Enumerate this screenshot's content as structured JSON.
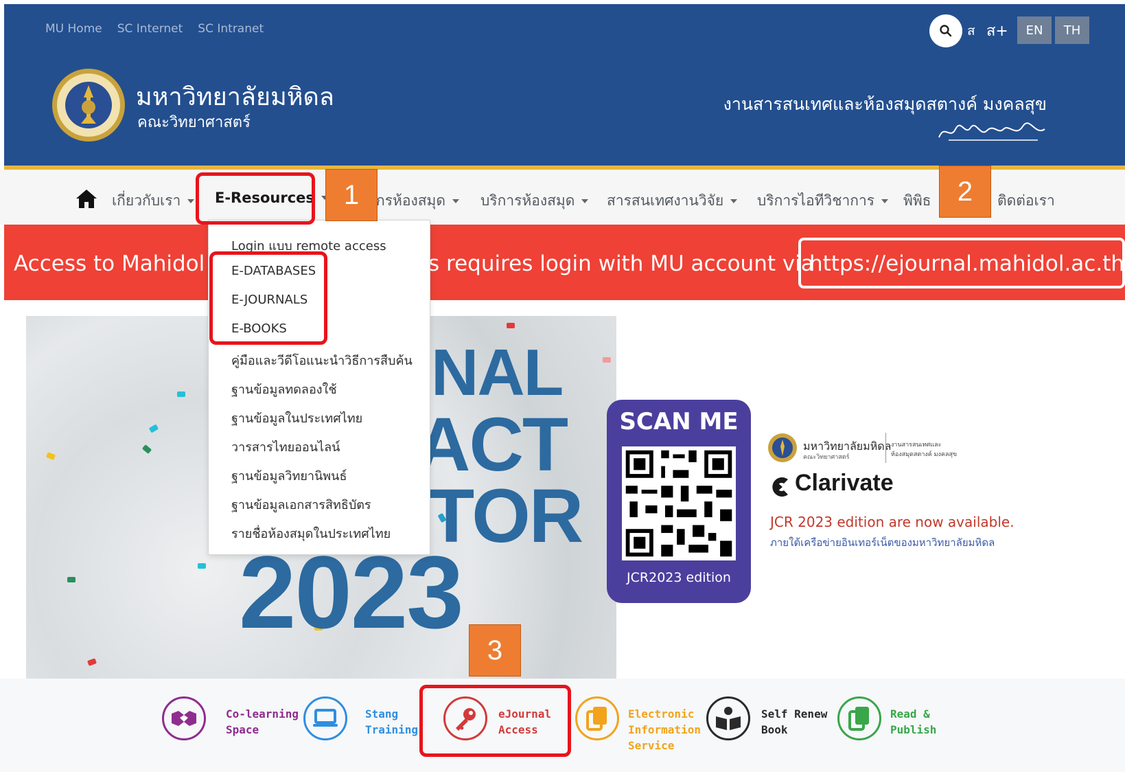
{
  "toplinks": [
    "MU Home",
    "SC Internet",
    "SC Intranet"
  ],
  "header": {
    "font_small": "ส",
    "font_large": "ส+",
    "lang_en": "EN",
    "lang_th": "TH",
    "university": "มหาวิทยาลัยมหิดล",
    "faculty": "คณะวิทยาศาสตร์",
    "library": "งานสารสนเทศและห้องสมุดสตางค์ มงคลสุข"
  },
  "nav": {
    "about": "เกี่ยวกับเรา",
    "eresources": "E-Resources",
    "library_info": "กรห้องสมุด",
    "library_services": "บริการห้องสมุด",
    "research": "สารสนเทศงานวิจัย",
    "academic_it": "บริการไอทีวิชาการ",
    "museum": "พิพิธ",
    "contact": "ติดต่อเรา"
  },
  "banner": {
    "left": "Access to Mahidol",
    "middle": "s requires login with MU account via",
    "url": "https://ejournal.mahidol.ac.th"
  },
  "dropdown": [
    "Login แบบ remote access",
    "E-DATABASES",
    "E-JOURNALS",
    "E-BOOKS",
    "คู่มือและวีดีโอแนะนำวิธีการสืบค้น",
    "ฐานข้อมูลทดลองใช้",
    "ฐานข้อมูลในประเทศไทย",
    "วารสารไทยออนไลน์",
    "ฐานข้อมูลวิทยานิพนธ์",
    "ฐานข้อมูลเอกสารสิทธิบัตร",
    "รายชื่อห้องสมุดในประเทศไทย"
  ],
  "hero": {
    "word1": "NAL",
    "word2": "ACT",
    "word3": "TOR",
    "word4": "2023",
    "scan_title": "SCAN ME",
    "scan_sub": "JCR2023 edition",
    "mini_uni": "มหาวิทยาลัยมหิดล",
    "mini_fac": "คณะวิทยาศาสตร์",
    "mini_lib1": "งานสารสนเทศและ",
    "mini_lib2": "ห้องสมุดสตางค์ มงคลสุข",
    "clarivate": "Clarivate",
    "jcr_line": "JCR 2023 edition are now available.",
    "jcr_thai": "ภายใต้เครือข่ายอินเทอร์เน็ตของมหาวิทยาลัยมหิดล"
  },
  "quick_links": [
    {
      "line1": "Co-learning",
      "line2": "Space",
      "line3": "",
      "color": "#8e2d8e"
    },
    {
      "line1": "Stang",
      "line2": "Training",
      "line3": "",
      "color": "#2f8ee0"
    },
    {
      "line1": "eJournal",
      "line2": "Access",
      "line3": "",
      "color": "#d33a3a"
    },
    {
      "line1": "Electronic",
      "line2": "Information",
      "line3": "Service",
      "color": "#f2a31b"
    },
    {
      "line1": "Self Renew",
      "line2": "Book",
      "line3": "",
      "color": "#2a2a2a"
    },
    {
      "line1": "Read &",
      "line2": "Publish",
      "line3": "",
      "color": "#3aa64a"
    }
  ],
  "annotations": {
    "n1": "1",
    "n2": "2",
    "n3": "3"
  }
}
